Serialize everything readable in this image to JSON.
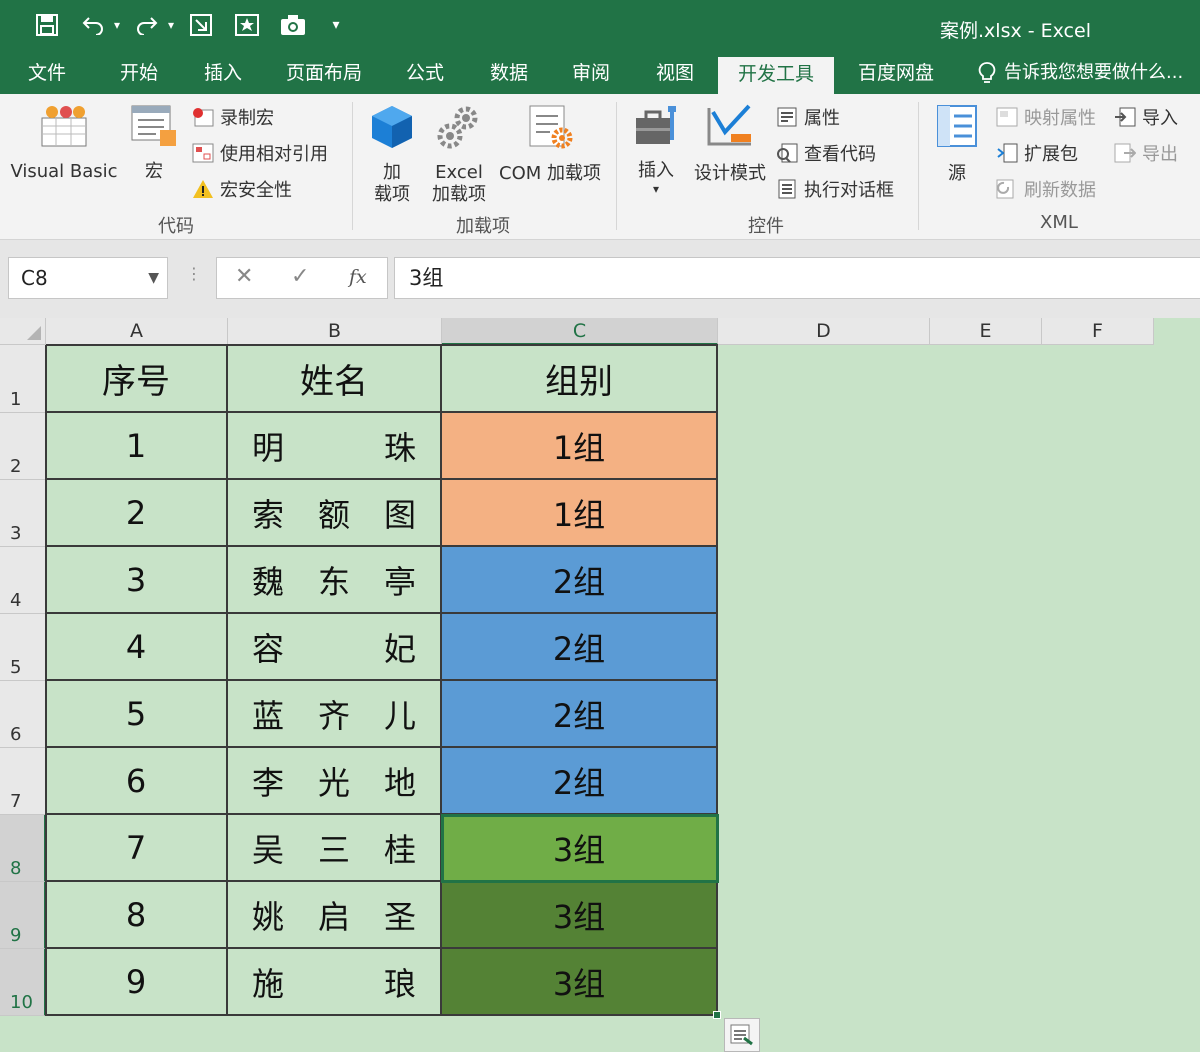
{
  "window": {
    "title": "案例.xlsx - Excel"
  },
  "tabs": [
    {
      "label": "文件",
      "active": false
    },
    {
      "label": "开始",
      "active": false
    },
    {
      "label": "插入",
      "active": false
    },
    {
      "label": "页面布局",
      "active": false
    },
    {
      "label": "公式",
      "active": false
    },
    {
      "label": "数据",
      "active": false
    },
    {
      "label": "审阅",
      "active": false
    },
    {
      "label": "视图",
      "active": false
    },
    {
      "label": "开发工具",
      "active": true
    },
    {
      "label": "百度网盘",
      "active": false
    }
  ],
  "tell_me": "告诉我您想要做什么...",
  "ribbon": {
    "code": {
      "label": "代码",
      "visual_basic": "Visual Basic",
      "macros": "宏",
      "record_macro": "录制宏",
      "relative_ref": "使用相对引用",
      "macro_security": "宏安全性"
    },
    "addins": {
      "label": "加载项",
      "addins_line1": "加",
      "addins_line2": "载项",
      "excel_line1": "Excel",
      "excel_line2": "加载项",
      "com": "COM 加载项"
    },
    "controls": {
      "label": "控件",
      "insert": "插入",
      "design_mode": "设计模式",
      "properties": "属性",
      "view_code": "查看代码",
      "run_dialog": "执行对话框"
    },
    "xml": {
      "label": "XML",
      "source": "源",
      "map_properties": "映射属性",
      "expansion_packs": "扩展包",
      "refresh_data": "刷新数据",
      "import": "导入",
      "export": "导出"
    }
  },
  "formula_bar": {
    "name_box": "C8",
    "fx": "fx",
    "value": "3组"
  },
  "sheet": {
    "columns": [
      "A",
      "B",
      "C",
      "D",
      "E",
      "F"
    ],
    "rows": [
      "1",
      "2",
      "3",
      "4",
      "5",
      "6",
      "7",
      "8",
      "9",
      "10"
    ],
    "header": [
      "序号",
      "姓名",
      "组别"
    ],
    "data": [
      {
        "no": "1",
        "name": [
          "明",
          "珠"
        ],
        "group": "1组"
      },
      {
        "no": "2",
        "name": [
          "索",
          "额",
          "图"
        ],
        "group": "1组"
      },
      {
        "no": "3",
        "name": [
          "魏",
          "东",
          "亭"
        ],
        "group": "2组"
      },
      {
        "no": "4",
        "name": [
          "容",
          "妃"
        ],
        "group": "2组"
      },
      {
        "no": "5",
        "name": [
          "蓝",
          "齐",
          "儿"
        ],
        "group": "2组"
      },
      {
        "no": "6",
        "name": [
          "李",
          "光",
          "地"
        ],
        "group": "2组"
      },
      {
        "no": "7",
        "name": [
          "吴",
          "三",
          "桂"
        ],
        "group": "3组"
      },
      {
        "no": "8",
        "name": [
          "姚",
          "启",
          "圣"
        ],
        "group": "3组"
      },
      {
        "no": "9",
        "name": [
          "施",
          "琅"
        ],
        "group": "3组"
      }
    ],
    "group_colors": {
      "1组": "#f4b183",
      "2组": "#5b9bd5",
      "3组_light": "#70ad47",
      "3组_dark": "#548235"
    },
    "selected_cell": "C8"
  },
  "colors": {
    "excel_green": "#217346",
    "sheet_background": "#c8e3c8"
  }
}
